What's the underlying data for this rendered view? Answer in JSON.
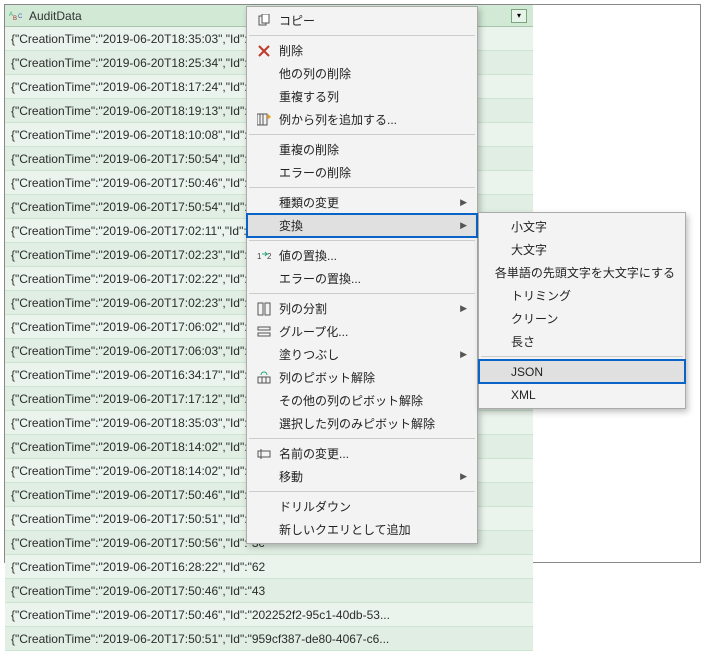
{
  "column": {
    "type_icon": "ABC",
    "name": "AuditData"
  },
  "rows": [
    "{\"CreationTime\":\"2019-06-20T18:35:03\",\"Id\":\"1c",
    "{\"CreationTime\":\"2019-06-20T18:25:34\",\"Id\":\"d0",
    "{\"CreationTime\":\"2019-06-20T18:17:24\",\"Id\":\"3e",
    "{\"CreationTime\":\"2019-06-20T18:19:13\",\"Id\":\"be",
    "{\"CreationTime\":\"2019-06-20T18:10:08\",\"Id\":\"a5",
    "{\"CreationTime\":\"2019-06-20T17:50:54\",\"Id\":\"97",
    "{\"CreationTime\":\"2019-06-20T17:50:46\",\"Id\":\"1f",
    "{\"CreationTime\":\"2019-06-20T17:50:54\",\"Id\":\"f3",
    "{\"CreationTime\":\"2019-06-20T17:02:11\",\"Id\":\"ed",
    "{\"CreationTime\":\"2019-06-20T17:02:23\",\"Id\":\"4a",
    "{\"CreationTime\":\"2019-06-20T17:02:22\",\"Id\":\"b3",
    "{\"CreationTime\":\"2019-06-20T17:02:23\",\"Id\":\"02",
    "{\"CreationTime\":\"2019-06-20T17:06:02\",\"Id\":\"69",
    "{\"CreationTime\":\"2019-06-20T17:06:03\",\"Id\":\"fd",
    "{\"CreationTime\":\"2019-06-20T16:34:17\",\"Id\":\"fe",
    "{\"CreationTime\":\"2019-06-20T17:17:12\",\"Id\":\"07",
    "{\"CreationTime\":\"2019-06-20T18:35:03\",\"Id\":\"1c",
    "{\"CreationTime\":\"2019-06-20T18:14:02\",\"Id\":\"20",
    "{\"CreationTime\":\"2019-06-20T18:14:02\",\"Id\":\"20",
    "{\"CreationTime\":\"2019-06-20T17:50:46\",\"Id\":\"20",
    "{\"CreationTime\":\"2019-06-20T17:50:51\",\"Id\":\"95",
    "{\"CreationTime\":\"2019-06-20T17:50:56\",\"Id\":\"3c",
    "{\"CreationTime\":\"2019-06-20T16:28:22\",\"Id\":\"62",
    "{\"CreationTime\":\"2019-06-20T17:50:46\",\"Id\":\"43",
    "{\"CreationTime\":\"2019-06-20T17:50:46\",\"Id\":\"202252f2-95c1-40db-53...",
    "{\"CreationTime\":\"2019-06-20T17:50:51\",\"Id\":\"959cf387-de80-4067-c6..."
  ],
  "menu1": {
    "copy": "コピー",
    "remove": "削除",
    "remove_others": "他の列の削除",
    "duplicate_col": "重複する列",
    "add_col_from_ex": "例から列を追加する...",
    "remove_dup": "重複の削除",
    "remove_err": "エラーの削除",
    "change_type": "種類の変更",
    "transform": "変換",
    "replace_val": "値の置換...",
    "replace_err": "エラーの置換...",
    "split_col": "列の分割",
    "group_by": "グループ化...",
    "fill": "塗りつぶし",
    "unpivot": "列のピボット解除",
    "unpivot_other": "その他の列のピボット解除",
    "unpivot_sel": "選択した列のみピボット解除",
    "rename": "名前の変更...",
    "move": "移動",
    "drill": "ドリルダウン",
    "add_as_query": "新しいクエリとして追加"
  },
  "menu2": {
    "lower": "小文字",
    "upper": "大文字",
    "cap": "各単語の先頭文字を大文字にする",
    "trim": "トリミング",
    "clean": "クリーン",
    "length": "長さ",
    "json": "JSON",
    "xml": "XML"
  }
}
